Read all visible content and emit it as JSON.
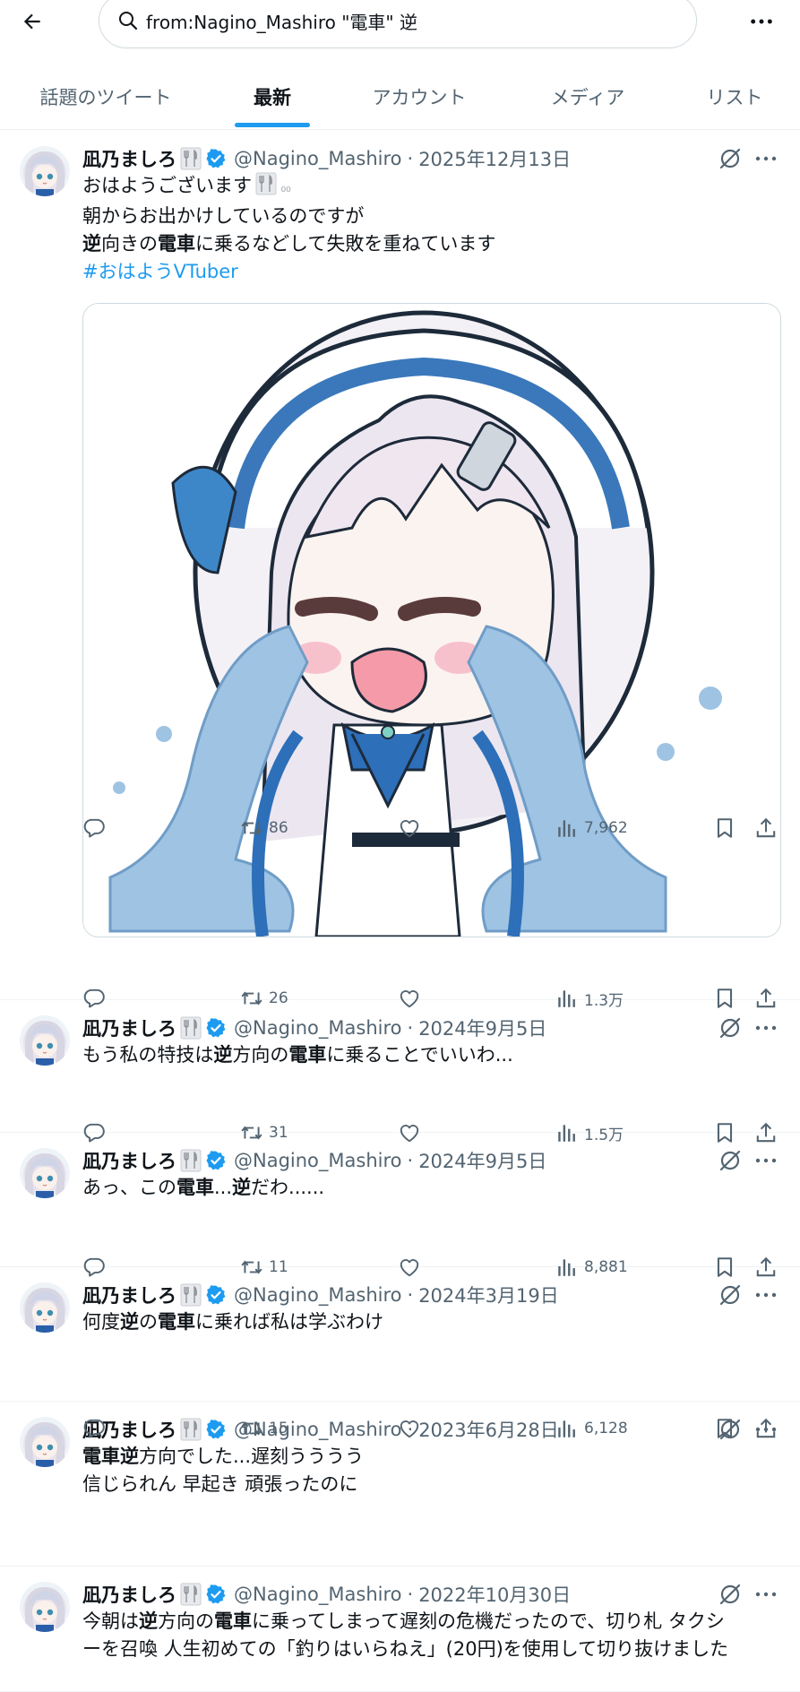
{
  "search": {
    "value": "from:Nagino_Mashiro \"電車\" 逆"
  },
  "tabs": [
    {
      "label": "話題のツイート"
    },
    {
      "label": "最新"
    },
    {
      "label": "アカウント"
    },
    {
      "label": "メディア"
    },
    {
      "label": "リスト"
    }
  ],
  "active_tab": "最新",
  "colors": {
    "accent": "#1d9bf0",
    "secondary_text": "#536471",
    "verified": "#1d9bf0"
  },
  "icons": [
    "back-arrow-icon",
    "search-icon",
    "more-icon",
    "fork-knife-icon",
    "verified-icon",
    "grok-icon",
    "reply-icon",
    "retweet-icon",
    "like-icon",
    "views-icon",
    "bookmark-icon",
    "share-icon"
  ],
  "author": {
    "name": "凪乃ましろ",
    "handle": "@Nagino_Mashiro"
  },
  "tweets": [
    {
      "date": "2025年12月13日",
      "lines": [
        [
          {
            "t": "おはようございます"
          }
        ],
        [
          {
            "t": "朝からお出かけしているのですが"
          }
        ],
        [
          {
            "t": "逆",
            "b": true
          },
          {
            "t": "向きの"
          },
          {
            "t": "電車",
            "b": true
          },
          {
            "t": "に乗るなどして失敗を重ねています"
          }
        ],
        [
          {
            "t": "#おはようVTuber",
            "h": true
          }
        ]
      ],
      "media_alt": "crying chibi character illustration",
      "retweets": "86",
      "views": "7,962"
    },
    {
      "date": "2024年9月5日",
      "lines": [
        [
          {
            "t": "もう私の特技は"
          },
          {
            "t": "逆",
            "b": true
          },
          {
            "t": "方向の"
          },
          {
            "t": "電車",
            "b": true
          },
          {
            "t": "に乗ることでいいわ..."
          }
        ]
      ],
      "retweets": "26",
      "views": "1.3万"
    },
    {
      "date": "2024年9月5日",
      "lines": [
        [
          {
            "t": "あっ、この"
          },
          {
            "t": "電車",
            "b": true
          },
          {
            "t": "..."
          },
          {
            "t": "逆",
            "b": true
          },
          {
            "t": "だわ......"
          }
        ]
      ],
      "retweets": "31",
      "views": "1.5万"
    },
    {
      "date": "2024年3月19日",
      "lines": [
        [
          {
            "t": "何度"
          },
          {
            "t": "逆",
            "b": true
          },
          {
            "t": "の"
          },
          {
            "t": "電車",
            "b": true
          },
          {
            "t": "に乗れば私は学ぶわけ"
          }
        ]
      ],
      "retweets": "11",
      "views": "8,881"
    },
    {
      "date": "2023年6月28日",
      "lines": [
        [
          {
            "t": "電車",
            "b": true
          },
          {
            "t": "逆",
            "b": true
          },
          {
            "t": "方向でした...遅刻うううう"
          }
        ],
        [
          {
            "t": "信じられん 早起き 頑張ったのに"
          }
        ]
      ],
      "retweets": "15",
      "views": "6,128"
    },
    {
      "date": "2022年10月30日",
      "lines": [
        [
          {
            "t": "今朝は"
          },
          {
            "t": "逆",
            "b": true
          },
          {
            "t": "方向の"
          },
          {
            "t": "電車",
            "b": true
          },
          {
            "t": "に乗ってしまって遅刻の危機だったので、切り札 タクシ"
          }
        ],
        [
          {
            "t": "ーを召喚 人生初めての「釣りはいらねえ」(20円)を使用して切り抜けました"
          }
        ]
      ]
    }
  ]
}
